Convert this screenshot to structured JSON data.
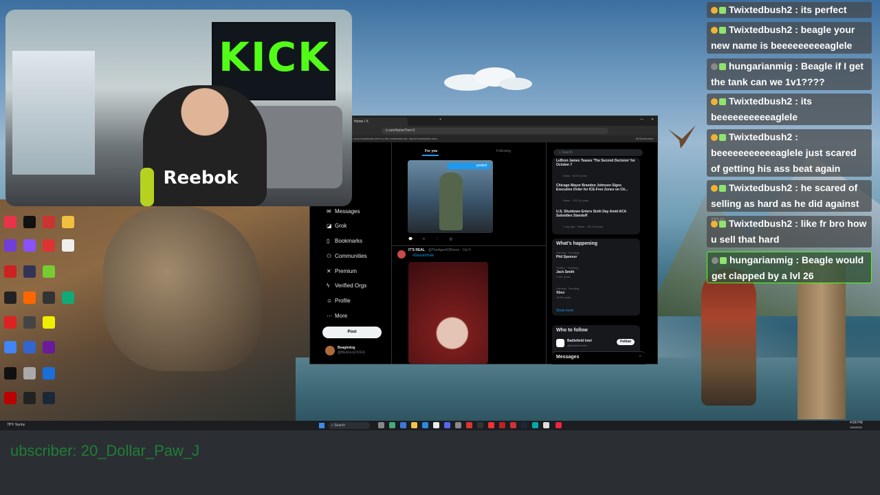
{
  "browser": {
    "tab_title": "Home / X",
    "url": "x.com/home?mx=2",
    "bookmarks_hint": "r your bookmarks here on the bookmarks bar. Import bookmarks now...",
    "all_bookmarks": "All Bookmarks"
  },
  "x": {
    "tabs": [
      "For you",
      "Following"
    ],
    "nav": [
      {
        "label": "ations",
        "icon": "bell-icon"
      },
      {
        "label": "Messages",
        "icon": "envelope-icon"
      },
      {
        "label": "Grok",
        "icon": "grok-icon"
      },
      {
        "label": "Bookmarks",
        "icon": "bookmark-icon"
      },
      {
        "label": "Communities",
        "icon": "communities-icon"
      },
      {
        "label": "Premium",
        "icon": "x-icon"
      },
      {
        "label": "Verified Orgs",
        "icon": "lightning-icon"
      },
      {
        "label": "Profile",
        "icon": "person-icon"
      },
      {
        "label": "More",
        "icon": "more-icon"
      }
    ],
    "post_button": "Post",
    "profile_name": "Beagledog",
    "profile_handle": "@BEAGLEDOGS",
    "posted_badge": "posted",
    "tweet_author": "IT'S REAL",
    "tweet_handle": "@TheAgentOfDoom · Oct 5",
    "tweet_tag": "#GhostofYotei",
    "search_placeholder": "Search",
    "news": [
      {
        "title": "LeBron James Teases 'The Second Decision' for October 7",
        "meta": "News · 56.2K posts"
      },
      {
        "title": "Chicago Mayor Brandon Johnson Signs Executive Order for ICE-Free Zones on Cit...",
        "meta": "News · 125.7K posts"
      },
      {
        "title": "U.S. Shutdown Enters Sixth Day Amid ACA Subsidies Standoff",
        "meta": "1 day ago · News · 261.2K posts"
      }
    ],
    "whats_happening": "What's happening",
    "trends": [
      {
        "context": "Gaming · Trending",
        "name": "Phil Spencer",
        "meta": ""
      },
      {
        "context": "Politics · Trending",
        "name": "Jack Smith",
        "meta": "2,467 posts"
      },
      {
        "context": "Gaming · Trending",
        "name": "Xbox",
        "meta": "18.5K posts"
      }
    ],
    "show_more": "Show more",
    "who_to_follow": "Who to follow",
    "follow_suggestion": "Battlefield Intel",
    "follow_suggestion_handle": "@BattlefieldIntel",
    "follow_button": "Follow",
    "messages_drawer": "Messages"
  },
  "chat": [
    {
      "user": "Twixtedbush2",
      "text": " : its perfect",
      "badge": "gold"
    },
    {
      "user": "Twixtedbush2",
      "text": " : beagle your new name is beeeeeeeeeaglele",
      "badge": "gold"
    },
    {
      "user": "hungarianmig",
      "text": " : Beagle if I get the tank can we 1v1????",
      "badge": "grey"
    },
    {
      "user": "Twixtedbush2",
      "text": " : its beeeeeeeeeeaglele",
      "badge": "gold"
    },
    {
      "user": "Twixtedbush2",
      "text": " : beeeeeeeeeeeaglele just scared of getting his ass beat again",
      "badge": "gold"
    },
    {
      "user": "Twixtedbush2",
      "text": " : he scared of selling as hard as he did against me",
      "badge": "gold"
    },
    {
      "user": "Twixtedbush2",
      "text": " : like fr bro how u sell that hard",
      "badge": "gold"
    },
    {
      "user": "hungarianmig",
      "text": " : Beagle would get clapped by a lvl 26",
      "badge": "grey"
    }
  ],
  "webcam": {
    "banner_text": "KICK",
    "shirt_text": "Reebok"
  },
  "taskbar": {
    "search": "Search",
    "time": "4:58 PM",
    "date": "10/6/2025",
    "weather": "78°F Sunny"
  },
  "overlay": {
    "subscriber_text": "ubscriber: 20_Dollar_Paw_J"
  }
}
